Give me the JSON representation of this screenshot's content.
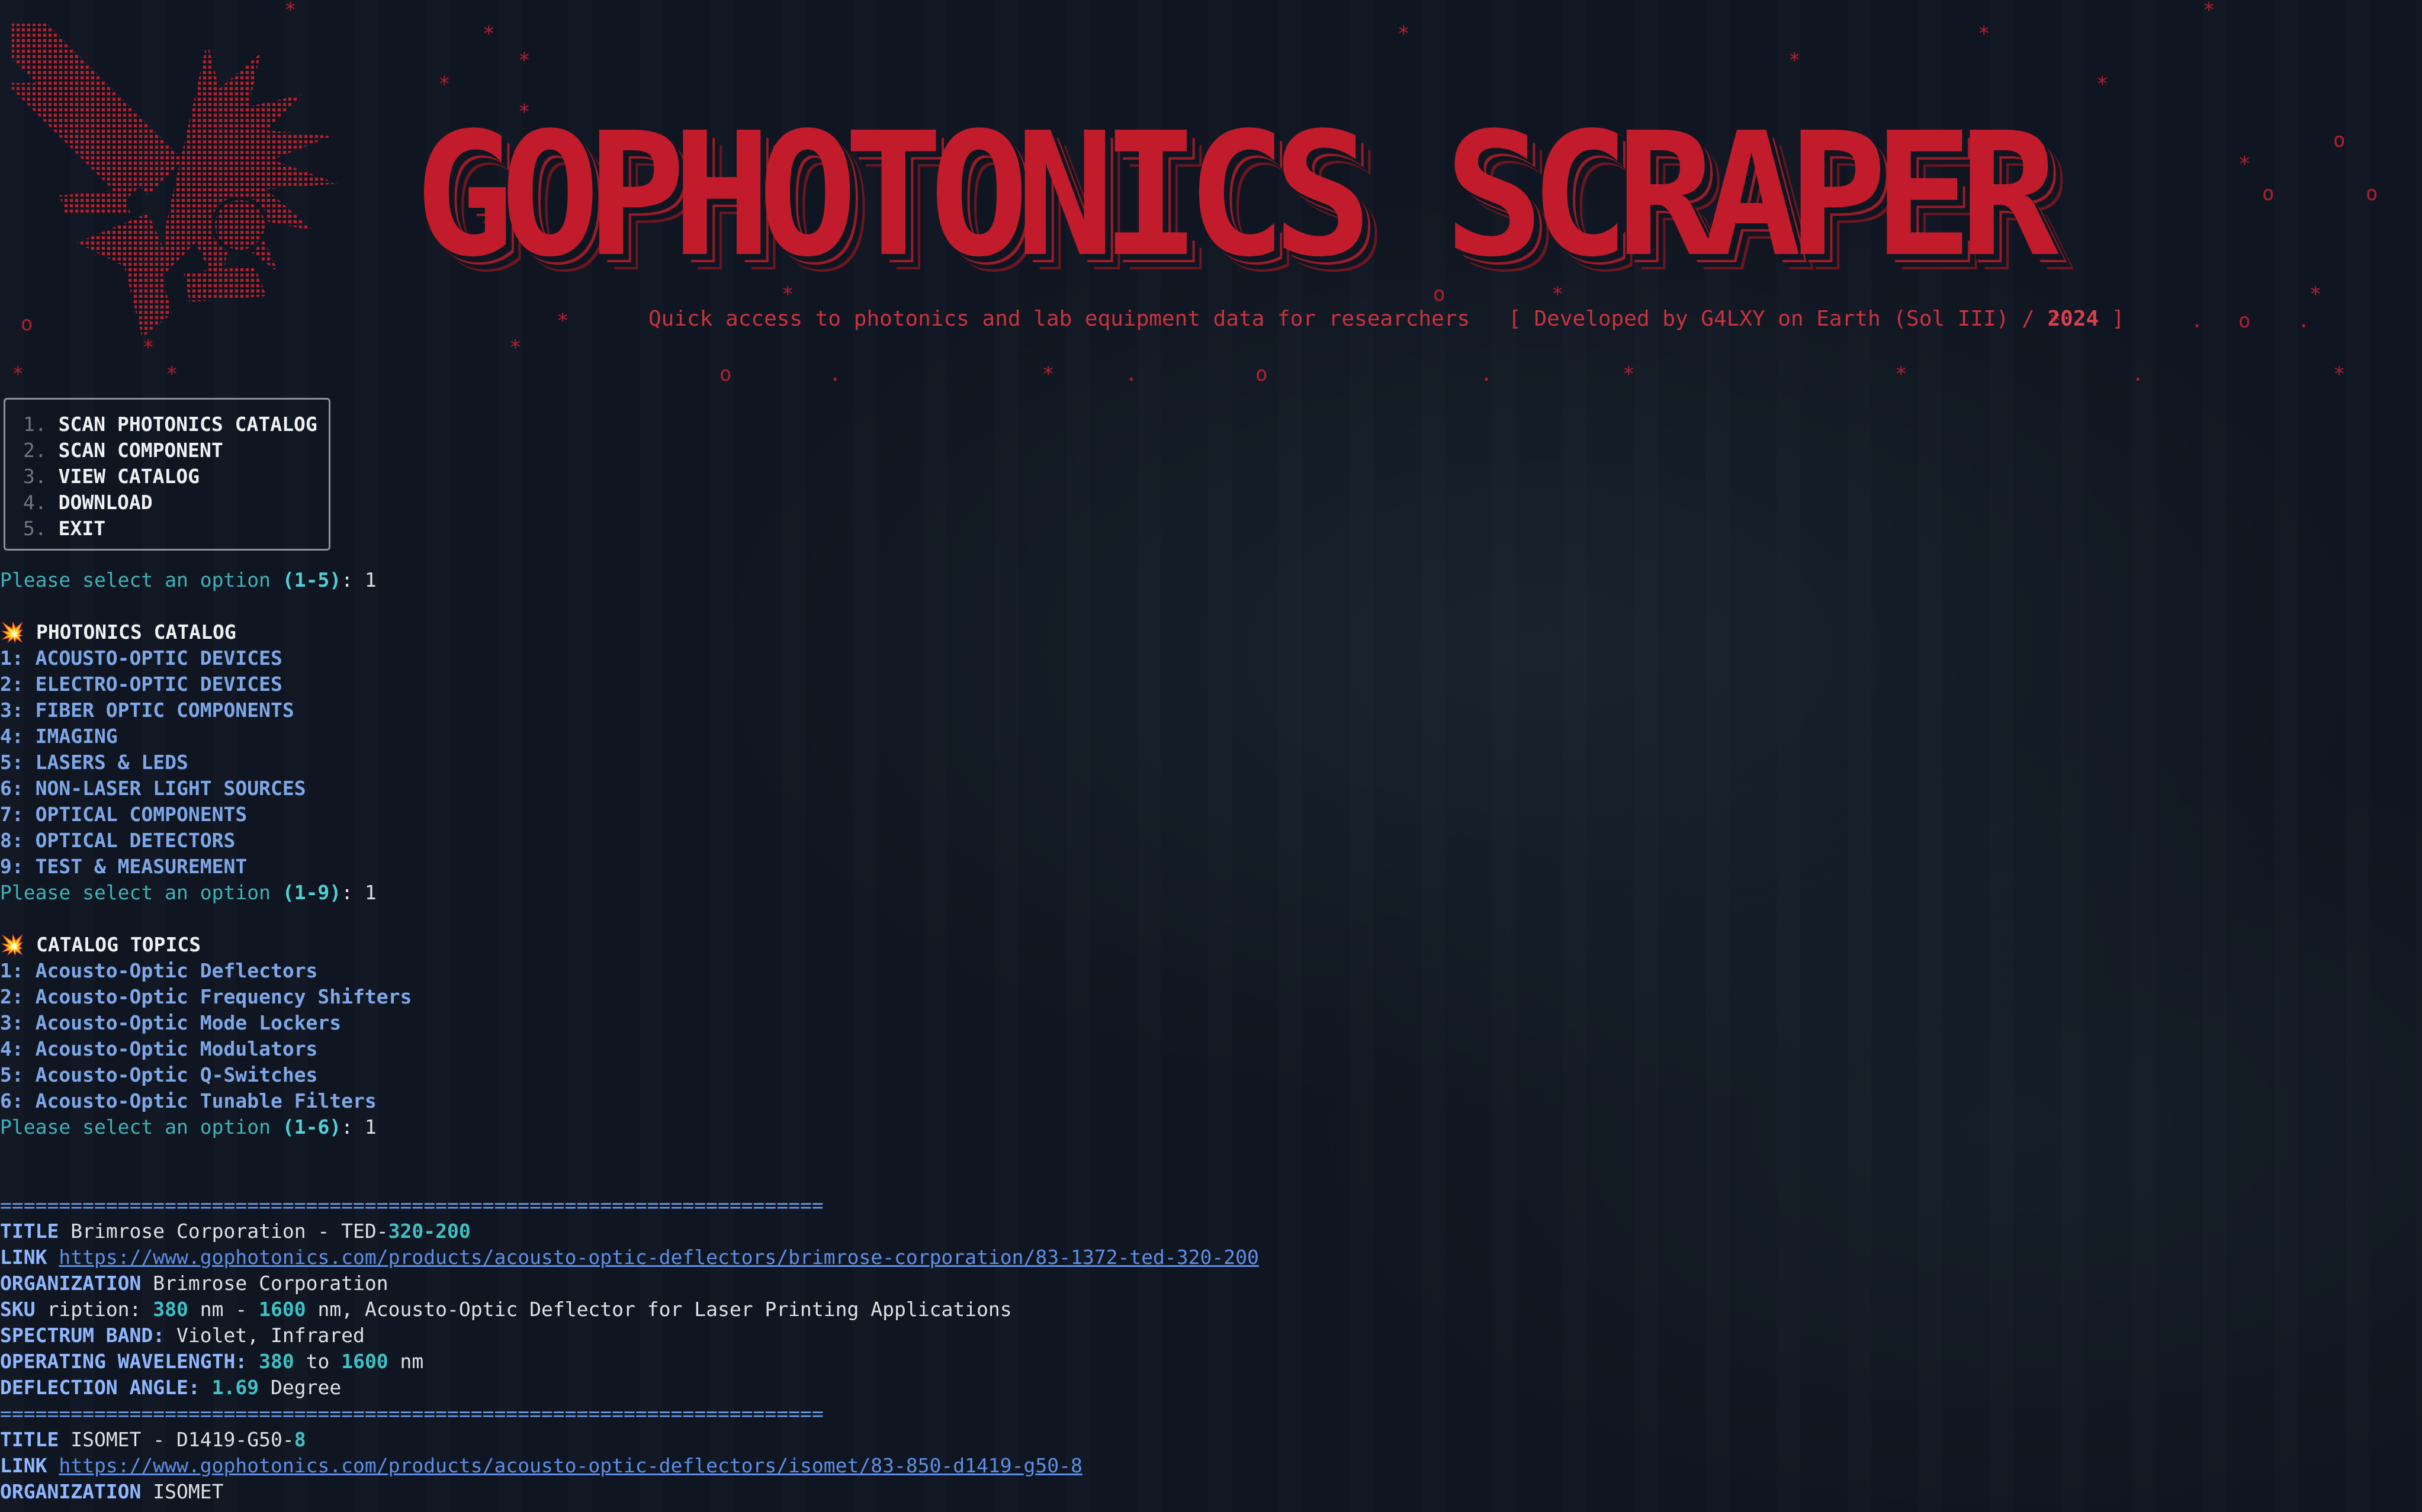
{
  "banner": {
    "title": "GOPHOTONICS SCRAPER",
    "tagline": "Quick access to photonics and lab equipment data for researchers",
    "dev_open": "[ Developed by G4LXY on Earth (Sol III) / ",
    "dev_year": "2024",
    "dev_close": " ]",
    "accent_color": "#c21c2c"
  },
  "main_menu": {
    "items": [
      {
        "num": "1.",
        "label": "SCAN PHOTONICS CATALOG"
      },
      {
        "num": "2.",
        "label": "SCAN COMPONENT"
      },
      {
        "num": "3.",
        "label": "VIEW CATALOG"
      },
      {
        "num": "4.",
        "label": "DOWNLOAD"
      },
      {
        "num": "5.",
        "label": "EXIT"
      }
    ],
    "prompt": "Please select an option ",
    "range": "(1-5)",
    "answer": ": 1"
  },
  "catalog": {
    "icon": "💥",
    "heading": "PHOTONICS CATALOG",
    "items": [
      "1: ACOUSTO-OPTIC DEVICES",
      "2: ELECTRO-OPTIC DEVICES",
      "3: FIBER OPTIC COMPONENTS",
      "4: IMAGING",
      "5: LASERS & LEDS",
      "6: NON-LASER LIGHT SOURCES",
      "7: OPTICAL COMPONENTS",
      "8: OPTICAL DETECTORS",
      "9: TEST & MEASUREMENT"
    ],
    "prompt": "Please select an option ",
    "range": "(1-9)",
    "answer": ": 1"
  },
  "topics": {
    "icon": "💥",
    "heading": "CATALOG TOPICS",
    "items": [
      "1: Acousto-Optic Deflectors",
      "2: Acousto-Optic Frequency Shifters",
      "3: Acousto-Optic Mode Lockers",
      "4: Acousto-Optic Modulators",
      "5: Acousto-Optic Q-Switches",
      "6: Acousto-Optic Tunable Filters"
    ],
    "prompt": "Please select an option ",
    "range": "(1-6)",
    "answer": ": 1"
  },
  "results": {
    "separator": "======================================================================",
    "record1": {
      "title_key": "TITLE",
      "title_text": " Brimrose Corporation - TED-",
      "title_num": "320-200",
      "link_key": "LINK",
      "link": "https://www.gophotonics.com/products/acousto-optic-deflectors/brimrose-corporation/83-1372-ted-320-200",
      "org_key": "ORGANIZATION",
      "org": " Brimrose Corporation",
      "sku_key": "SKU",
      "sku_a": " ription: ",
      "sku_n1": "380",
      "sku_b": " nm - ",
      "sku_n2": "1600",
      "sku_c": " nm, Acousto-Optic Deflector for Laser Printing Applications",
      "band_key": "SPECTRUM BAND:",
      "band": " Violet, Infrared",
      "wl_key": "OPERATING WAVELENGTH:",
      "wl_n1": "380",
      "wl_mid": " to ",
      "wl_n2": "1600",
      "wl_unit": " nm",
      "angle_key": "DEFLECTION ANGLE:",
      "angle_n": "1.69",
      "angle_unit": " Degree"
    },
    "record2": {
      "title_key": "TITLE",
      "title_text": " ISOMET - D1419-G50-",
      "title_num": "8",
      "link_key": "LINK",
      "link": "https://www.gophotonics.com/products/acousto-optic-deflectors/isomet/83-850-d1419-g50-8",
      "org_key": "ORGANIZATION",
      "org": " ISOMET"
    }
  }
}
